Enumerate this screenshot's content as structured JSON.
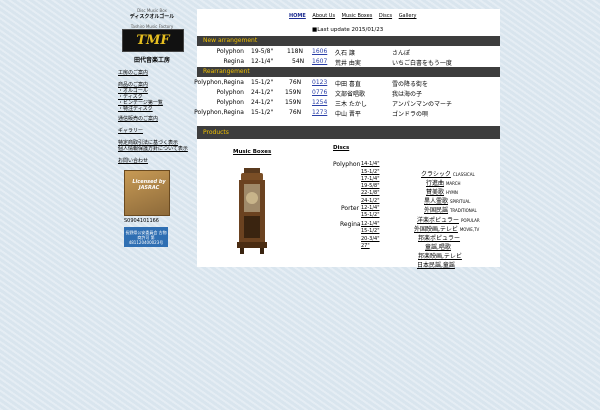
{
  "sidebar": {
    "brand_en": "Disc Music Box",
    "brand_jp": "ディスクオルゴール",
    "factory_en": "Tashiro Music Factory",
    "logo": "TMF",
    "factory_jp": "田代音楽工房",
    "links": [
      "工房のご案内",
      "商品のご案内",
      "・オルゴール",
      "・ディスク",
      "・ビンテージ第一覧",
      "・特注ディスク",
      "通信販売のご案内",
      "ギャラリー",
      "特定商取引法に基づく表示",
      "個人情報保護方針について表示",
      "お問い合わせ"
    ],
    "jasrac_label": "Licensed by JASRAC",
    "jasrac_number": "S0904101166",
    "badge_text": "長野県公安委員会 古物商許可 第481120400023号"
  },
  "nav": {
    "items": [
      "HOME",
      "About Us",
      "Music Boxes",
      "Discs",
      "Gallery"
    ]
  },
  "update": {
    "label": "■Last update",
    "date": "2015/01/23"
  },
  "new_arrangement": {
    "title": "New arrangement",
    "rows": [
      {
        "model": "Polyphon",
        "size": "19-5/8\"",
        "notes": "118N",
        "no": "1606",
        "artist": "久石 譲",
        "song": "さんぽ"
      },
      {
        "model": "Regina",
        "size": "12-1/4\"",
        "notes": "54N",
        "no": "1607",
        "artist": "荒井 由実",
        "song": "いちご白書をもう一度"
      }
    ]
  },
  "rearrangement": {
    "title": "Rearrangement",
    "rows": [
      {
        "model": "Polyphon,Regina",
        "size": "15-1/2\"",
        "notes": "76N",
        "no": "0123",
        "artist": "中田 喜直",
        "song": "雪の降る街を"
      },
      {
        "model": "Polyphon",
        "size": "24-1/2\"",
        "notes": "159N",
        "no": "0776",
        "artist": "文部省唱歌",
        "song": "我は海の子"
      },
      {
        "model": "Polyphon",
        "size": "24-1/2\"",
        "notes": "159N",
        "no": "1254",
        "artist": "三木 たかし",
        "song": "アンパンマンのマーチ"
      },
      {
        "model": "Polyphon,Regina",
        "size": "15-1/2\"",
        "notes": "76N",
        "no": "1273",
        "artist": "中山 晋平",
        "song": "ゴンドラの唄"
      }
    ]
  },
  "products": {
    "title": "Products",
    "music_boxes_label": "Music Boxes",
    "discs_label": "Discs",
    "disc_models": [
      {
        "model": "Polyphon",
        "sizes": [
          "14-1/4\"",
          "15-1/2\"",
          "17-1/4\"",
          "19-5/8\"",
          "22-1/8\"",
          "24-1/2\""
        ]
      },
      {
        "model": "Porter",
        "sizes": [
          "12-1/4\"",
          "15-1/2\""
        ]
      },
      {
        "model": "Regina",
        "sizes": [
          "12-1/4\"",
          "15-1/2\"",
          "20-3/4\"",
          "27\""
        ]
      }
    ],
    "genres": [
      {
        "jp": "クラシック",
        "en": "CLASSICAL"
      },
      {
        "jp": "行進曲",
        "en": "MARCH"
      },
      {
        "jp": "賛美歌",
        "en": "HYMN"
      },
      {
        "jp": "黒人霊歌",
        "en": "SPIRITUAL"
      },
      {
        "jp": "外国民謡",
        "en": "TRADITIONAL"
      },
      {
        "jp": "洋楽ポピュラー",
        "en": "POPULAR"
      },
      {
        "jp": "外国映画,テレビ",
        "en": "MOVIE,TV"
      },
      {
        "jp": "邦楽ポピュラー",
        "en": ""
      },
      {
        "jp": "童謡,唱歌",
        "en": ""
      },
      {
        "jp": "邦楽映画,テレビ",
        "en": ""
      },
      {
        "jp": "日本民謡,童謡",
        "en": ""
      }
    ]
  }
}
